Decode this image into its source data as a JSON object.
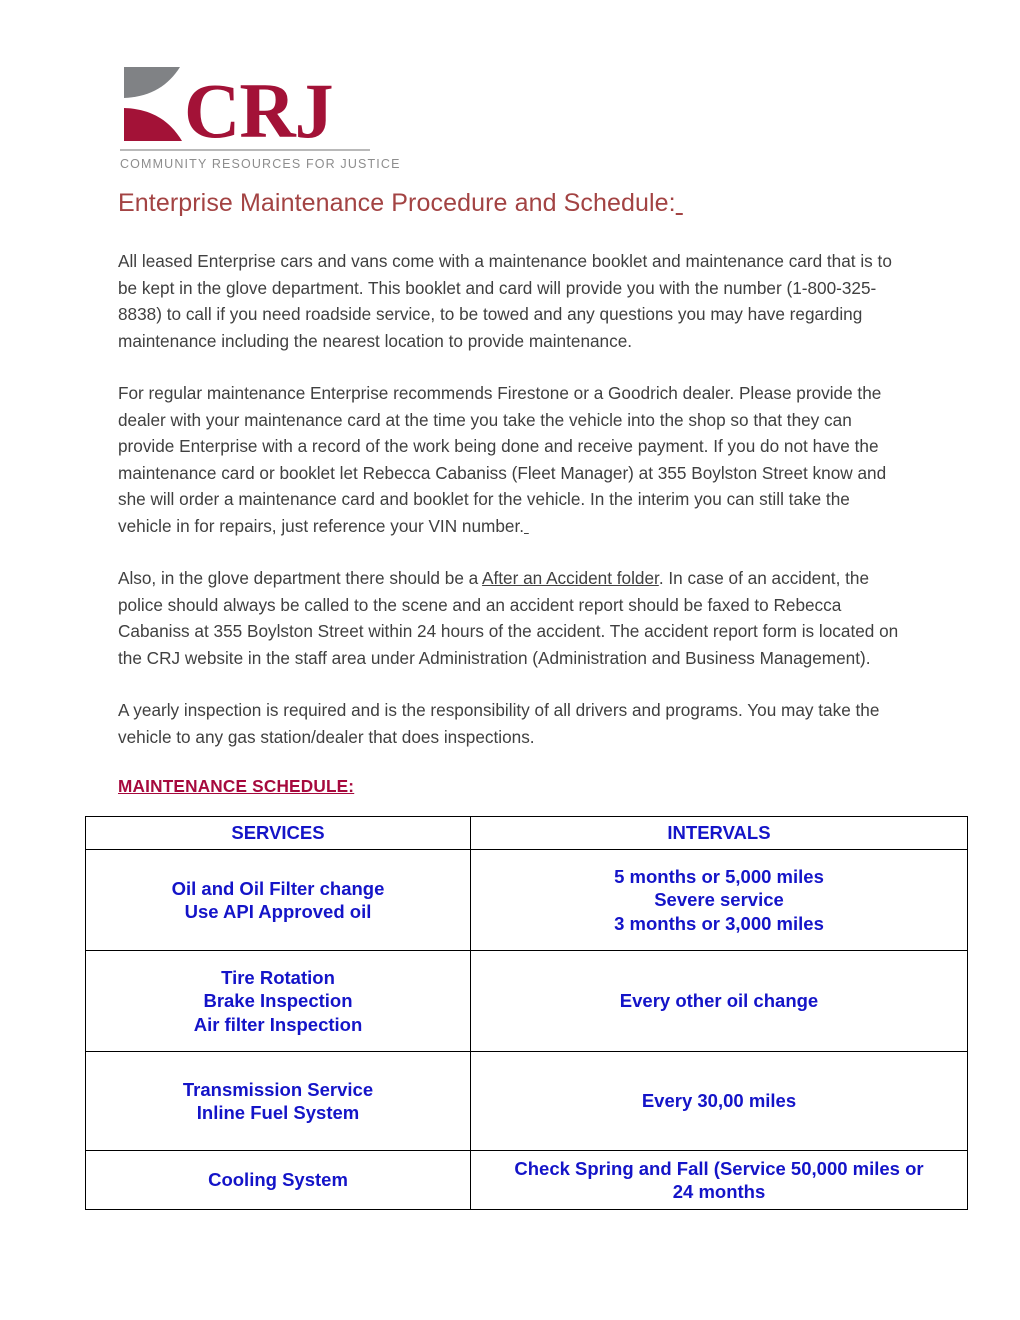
{
  "logo": {
    "mark_name": "crj-logo-mark",
    "wordmark": "CRJ",
    "tagline": "COMMUNITY RESOURCES FOR JUSTICE",
    "colors": {
      "crimson": "#a31237",
      "gray": "#8d8d8d"
    }
  },
  "document": {
    "title": "Enterprise Maintenance Procedure and Schedule:",
    "paragraphs": [
      "All leased Enterprise cars and vans come with a maintenance booklet and maintenance card that is to be kept in the glove department.  This booklet and card will provide you with the number (1-800-325-8838) to call if you need roadside service, to be towed and any questions you may have regarding maintenance including the nearest location to provide maintenance.",
      "For regular maintenance Enterprise recommends Firestone or a Goodrich dealer.  Please provide the dealer with your maintenance card at the time you take the vehicle into the shop so that they can provide Enterprise with a record of the work being done and receive payment. If you do not have the maintenance card or booklet let Rebecca Cabaniss (Fleet Manager) at 355 Boylston Street know and she will order a maintenance card and booklet for the vehicle. In the interim you can still take the vehicle in for repairs, just reference your VIN number.",
      "A yearly inspection is required and is the responsibility of all drivers and programs.  You may take the vehicle to any gas station/dealer that does inspections."
    ],
    "accident_paragraph": {
      "before": "Also, in the glove department there should be a ",
      "underlined": "After an Accident folder",
      "after": ".  In case of an accident, the police should always be called to the scene and an accident report should be faxed to Rebecca Cabaniss at 355 Boylston Street within 24 hours of the accident. The accident report form is located on the CRJ website in the staff area under Administration (Administration and Business Management)."
    },
    "section_heading": "MAINTENANCE SCHEDULE:",
    "title_color": "#a34343",
    "heading_color": "#a6093d",
    "body_color": "#404040"
  },
  "schedule_table": {
    "text_color": "#1414c8",
    "border_color": "#000000",
    "headers": [
      "SERVICES",
      "INTERVALS"
    ],
    "rows": [
      {
        "services": [
          "Oil and Oil Filter change",
          "Use API Approved oil"
        ],
        "intervals": [
          "5 months or 5,000 miles",
          "Severe service",
          "3 months or 3,000 miles"
        ]
      },
      {
        "services": [
          "Tire Rotation",
          "Brake Inspection",
          "Air filter Inspection"
        ],
        "intervals": [
          "Every other oil change"
        ]
      },
      {
        "services": [
          "Transmission Service",
          "Inline Fuel System"
        ],
        "intervals": [
          "Every 30,00 miles"
        ]
      },
      {
        "services": [
          "Cooling System"
        ],
        "intervals": [
          "Check Spring and Fall (Service 50,000 miles or",
          "24 months"
        ]
      }
    ]
  }
}
